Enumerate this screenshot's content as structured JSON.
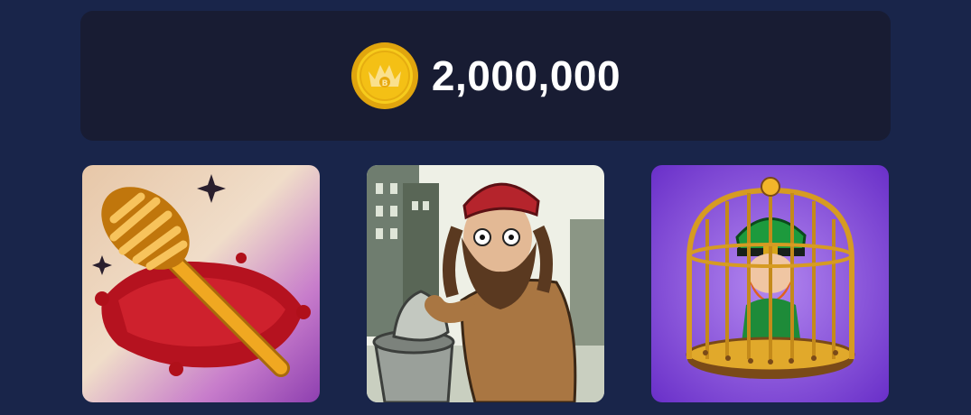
{
  "balance": {
    "icon": "crown-coin-icon",
    "amount": "2,000,000",
    "coin_color": "#f2c318"
  },
  "cards": [
    {
      "icon": "golden-toilet-brush-on-red-cushion"
    },
    {
      "icon": "homeless-man-with-trash-bag"
    },
    {
      "icon": "leprechaun-in-golden-cage"
    }
  ],
  "colors": {
    "background": "#19254a",
    "panel": "#181c33",
    "text": "#ffffff"
  }
}
